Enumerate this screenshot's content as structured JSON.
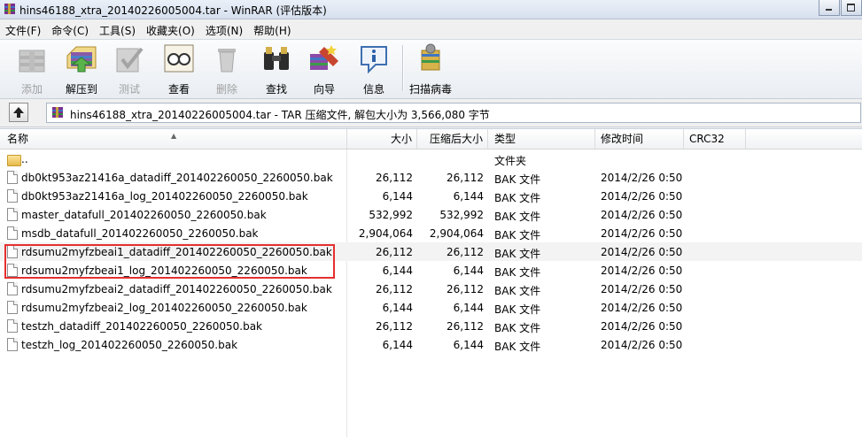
{
  "window": {
    "title": "hins46188_xtra_20140226005004.tar - WinRAR (评估版本)"
  },
  "menu": [
    {
      "label": "文件(F)"
    },
    {
      "label": "命令(C)"
    },
    {
      "label": "工具(S)"
    },
    {
      "label": "收藏夹(O)"
    },
    {
      "label": "选项(N)"
    },
    {
      "label": "帮助(H)"
    }
  ],
  "toolbar": {
    "add": "添加",
    "extract": "解压到",
    "test": "测试",
    "view": "查看",
    "delete": "删除",
    "find": "查找",
    "wizard": "向导",
    "info": "信息",
    "scan": "扫描病毒"
  },
  "address": {
    "text": "hins46188_xtra_20140226005004.tar - TAR 压缩文件, 解包大小为 3,566,080 字节"
  },
  "columns": {
    "name": "名称",
    "size": "大小",
    "packed": "压缩后大小",
    "type": "类型",
    "modified": "修改时间",
    "crc": "CRC32"
  },
  "files": [
    {
      "name": "..",
      "size": "",
      "packed": "",
      "type": "文件夹",
      "modified": "",
      "icon": "folder-icon"
    },
    {
      "name": "db0kt953az21416a_datadiff_201402260050_2260050.bak",
      "size": "26,112",
      "packed": "26,112",
      "type": "BAK 文件",
      "modified": "2014/2/26 0:50",
      "icon": "file-icon"
    },
    {
      "name": "db0kt953az21416a_log_201402260050_2260050.bak",
      "size": "6,144",
      "packed": "6,144",
      "type": "BAK 文件",
      "modified": "2014/2/26 0:50",
      "icon": "file-icon"
    },
    {
      "name": "master_datafull_201402260050_2260050.bak",
      "size": "532,992",
      "packed": "532,992",
      "type": "BAK 文件",
      "modified": "2014/2/26 0:50",
      "icon": "file-icon"
    },
    {
      "name": "msdb_datafull_201402260050_2260050.bak",
      "size": "2,904,064",
      "packed": "2,904,064",
      "type": "BAK 文件",
      "modified": "2014/2/26 0:50",
      "icon": "file-icon"
    },
    {
      "name": "rdsumu2myfzbeai1_datadiff_201402260050_2260050.bak",
      "size": "26,112",
      "packed": "26,112",
      "type": "BAK 文件",
      "modified": "2014/2/26 0:50",
      "icon": "file-icon"
    },
    {
      "name": "rdsumu2myfzbeai1_log_201402260050_2260050.bak",
      "size": "6,144",
      "packed": "6,144",
      "type": "BAK 文件",
      "modified": "2014/2/26 0:50",
      "icon": "file-icon"
    },
    {
      "name": "rdsumu2myfzbeai2_datadiff_201402260050_2260050.bak",
      "size": "26,112",
      "packed": "26,112",
      "type": "BAK 文件",
      "modified": "2014/2/26 0:50",
      "icon": "file-icon"
    },
    {
      "name": "rdsumu2myfzbeai2_log_201402260050_2260050.bak",
      "size": "6,144",
      "packed": "6,144",
      "type": "BAK 文件",
      "modified": "2014/2/26 0:50",
      "icon": "file-icon"
    },
    {
      "name": "testzh_datadiff_201402260050_2260050.bak",
      "size": "26,112",
      "packed": "26,112",
      "type": "BAK 文件",
      "modified": "2014/2/26 0:50",
      "icon": "file-icon"
    },
    {
      "name": "testzh_log_201402260050_2260050.bak",
      "size": "6,144",
      "packed": "6,144",
      "type": "BAK 文件",
      "modified": "2014/2/26 0:50",
      "icon": "file-icon"
    }
  ],
  "colors": {
    "highlight_border": "#e5302f"
  }
}
